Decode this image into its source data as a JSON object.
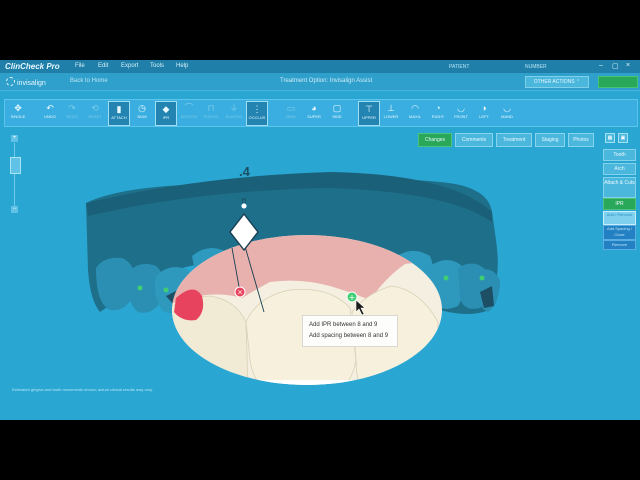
{
  "app": {
    "title": "ClinCheck Pro"
  },
  "menu": [
    "File",
    "Edit",
    "Export",
    "Tools",
    "Help"
  ],
  "patient": {
    "patient_label": "PATIENT",
    "number_label": "NUMBER"
  },
  "window_controls": {
    "minimize": "–",
    "maximize": "▢",
    "close": "×"
  },
  "header": {
    "logo": "invisalign",
    "back": "Back to Home",
    "treatment_option": "Treatment Option: Invisalign Assist",
    "other_actions": "OTHER ACTIONS ⌃"
  },
  "toolbar": [
    {
      "label": "Single",
      "icon": "✥",
      "active": false,
      "dim": false
    },
    {
      "label": "Undo",
      "icon": "↶",
      "active": false,
      "dim": false
    },
    {
      "label": "Redo",
      "icon": "↷",
      "active": false,
      "dim": true
    },
    {
      "label": "Reset",
      "icon": "⟲",
      "active": false,
      "dim": true
    },
    {
      "label": "Attach",
      "icon": "▮",
      "active": true,
      "dim": false
    },
    {
      "label": "Num",
      "icon": "◷",
      "active": false,
      "dim": false
    },
    {
      "label": "IPR",
      "icon": "◆",
      "active": true,
      "dim": false
    },
    {
      "label": "Bolton",
      "icon": "⌒",
      "active": false,
      "dim": true
    },
    {
      "label": "Pontic",
      "icon": "⊓",
      "active": false,
      "dim": true
    },
    {
      "label": "Elastic",
      "icon": "⏚",
      "active": false,
      "dim": true
    },
    {
      "label": "Grid",
      "icon": "▯",
      "active": false,
      "dim": true
    },
    {
      "label": "Occlus",
      "icon": "⋮",
      "active": true,
      "dim": false
    },
    {
      "label": "Bind",
      "icon": "▭",
      "active": false,
      "dim": true
    },
    {
      "label": "Super",
      "icon": "◕",
      "active": false,
      "dim": false
    },
    {
      "label": "Side",
      "icon": "▢",
      "active": false,
      "dim": false
    },
    {
      "label": "Upper",
      "icon": "⊤",
      "active": true,
      "dim": false
    },
    {
      "label": "Lower",
      "icon": "⊥",
      "active": false,
      "dim": false
    },
    {
      "label": "Maxil",
      "icon": "◠",
      "active": false,
      "dim": false
    },
    {
      "label": "Right",
      "icon": "◔",
      "active": false,
      "dim": false
    },
    {
      "label": "Front",
      "icon": "◡",
      "active": false,
      "dim": false
    },
    {
      "label": "Left",
      "icon": "◑",
      "active": false,
      "dim": false
    },
    {
      "label": "Mand",
      "icon": "◡",
      "active": false,
      "dim": false
    }
  ],
  "tabs": [
    "Changes",
    "Comments",
    "Treatment",
    "Staging",
    "Photos"
  ],
  "side_panel": [
    "Tooth",
    "Arch",
    "Attach & Cuts",
    "IPR"
  ],
  "side_sub": [
    "Add / Remove",
    "Add Spacing / Close",
    "Remove"
  ],
  "ipr_value": ".4",
  "tooltip": {
    "add_ipr": "Add IPR between 8 and 9",
    "add_spacing": "Add spacing between 8 and 9"
  },
  "disclaimer": "Estimated gingiva and tooth movements shown; actual clinical results may vary.",
  "colors": {
    "background": "#2aa6d2",
    "gingiva": "#1f6b84",
    "tooth": "#f1ead5",
    "accent_green": "#2aa85a",
    "ipr_marker": "#e8435e"
  }
}
